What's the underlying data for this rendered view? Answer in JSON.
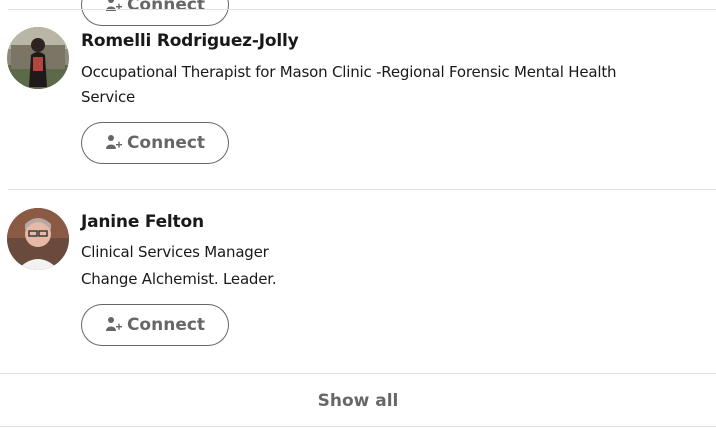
{
  "people": [
    {
      "name": "Romelli Rodriguez-Jolly",
      "headline_line1": "Occupational Therapist for Mason Clinic -Regional Forensic Mental Health",
      "headline_line2": "Service",
      "connect_label": "Connect"
    },
    {
      "name": "Janine Felton",
      "headline_line1": "Clinical Services Manager",
      "headline_line2": "Change Alchemist. Leader.",
      "connect_label": "Connect"
    }
  ],
  "previous_connect_label": "Connect",
  "show_all_label": "Show all",
  "icons": {
    "connect": "add-person-icon"
  },
  "colors": {
    "button_border": "#666666",
    "button_text": "#666666",
    "divider": "#e2e2e2"
  }
}
